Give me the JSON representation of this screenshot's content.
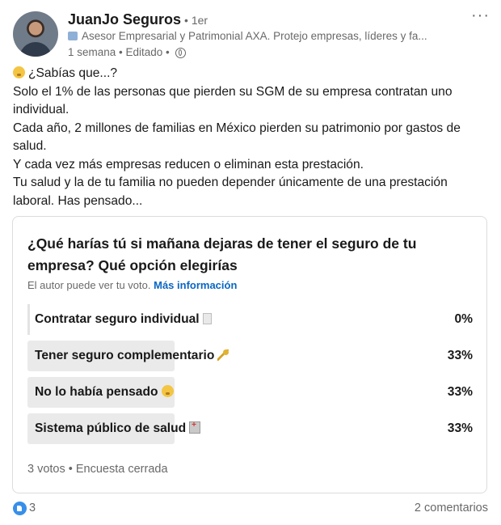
{
  "author": {
    "name": "JuanJo Seguros",
    "degree": "• 1er",
    "headline": "Asesor Empresarial y Patrimonial AXA. Protejo empresas, líderes y fa...",
    "meta": "1 semana • Editado •"
  },
  "post": {
    "lines": [
      "¿Sabías que...?",
      " Solo el 1% de las personas que pierden su SGM de su empresa contratan uno",
      "individual.",
      "Cada año, 2 millones de familias en México pierden su patrimonio por gastos de",
      "salud.",
      " Y cada vez más empresas reducen o eliminan esta prestación.",
      "Tu salud y la de tu familia no pueden depender únicamente de una prestación",
      "laboral. Has pensado..."
    ]
  },
  "poll": {
    "question": "¿Qué harías tú si mañana dejaras de tener el seguro de tu empresa? Qué opción elegirías",
    "note": "El autor puede ver tu voto.",
    "note_link": "Más información",
    "options": [
      {
        "label": "Contratar seguro individual",
        "percent": "0%",
        "share": 0
      },
      {
        "label": "Tener seguro complementario",
        "percent": "33%",
        "share": 33
      },
      {
        "label": "No lo había pensado",
        "percent": "33%",
        "share": 33
      },
      {
        "label": "Sistema público de salud",
        "percent": "33%",
        "share": 33
      }
    ],
    "footer": "3 votos • Encuesta cerrada"
  },
  "social": {
    "reactions": "3",
    "comments": "2 comentarios"
  }
}
